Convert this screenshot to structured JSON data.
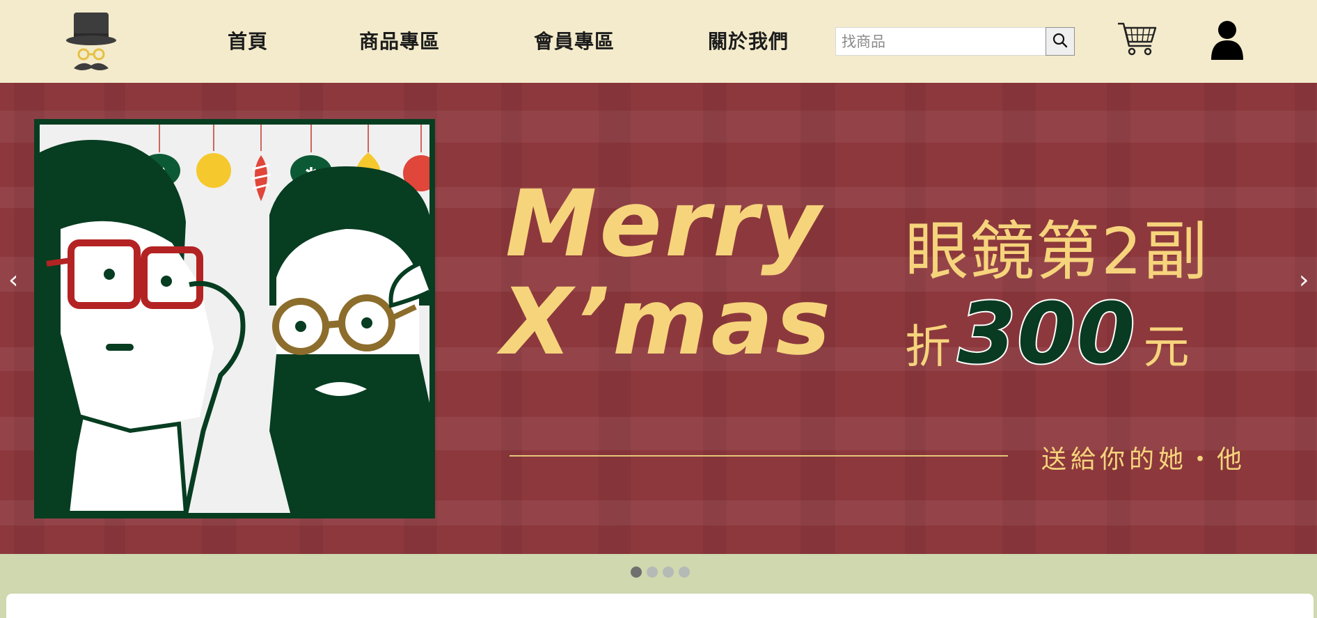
{
  "header": {
    "logo_icon": "top-hat-glasses-mustache-logo",
    "nav": [
      {
        "label": "首頁"
      },
      {
        "label": "商品專區"
      },
      {
        "label": "會員專區"
      },
      {
        "label": "關於我們"
      }
    ],
    "search": {
      "placeholder": "找商品",
      "value": "",
      "button_icon": "search-icon"
    },
    "cart_icon": "cart-icon",
    "user_icon": "user-icon"
  },
  "banner": {
    "merry_line1": "Merry",
    "merry_line2": "X’mas",
    "promo_line1": "眼鏡第2副",
    "promo_zhe": "折",
    "promo_amount": "300",
    "promo_yuan": "元",
    "tagline": "送給你的她・他",
    "prev_arrow": "‹",
    "next_arrow": "›",
    "colors": {
      "background": "#8d383d",
      "gold": "#f6d47c",
      "green": "#073d21"
    }
  },
  "carousel": {
    "slide_count": 4,
    "active_index": 0
  }
}
